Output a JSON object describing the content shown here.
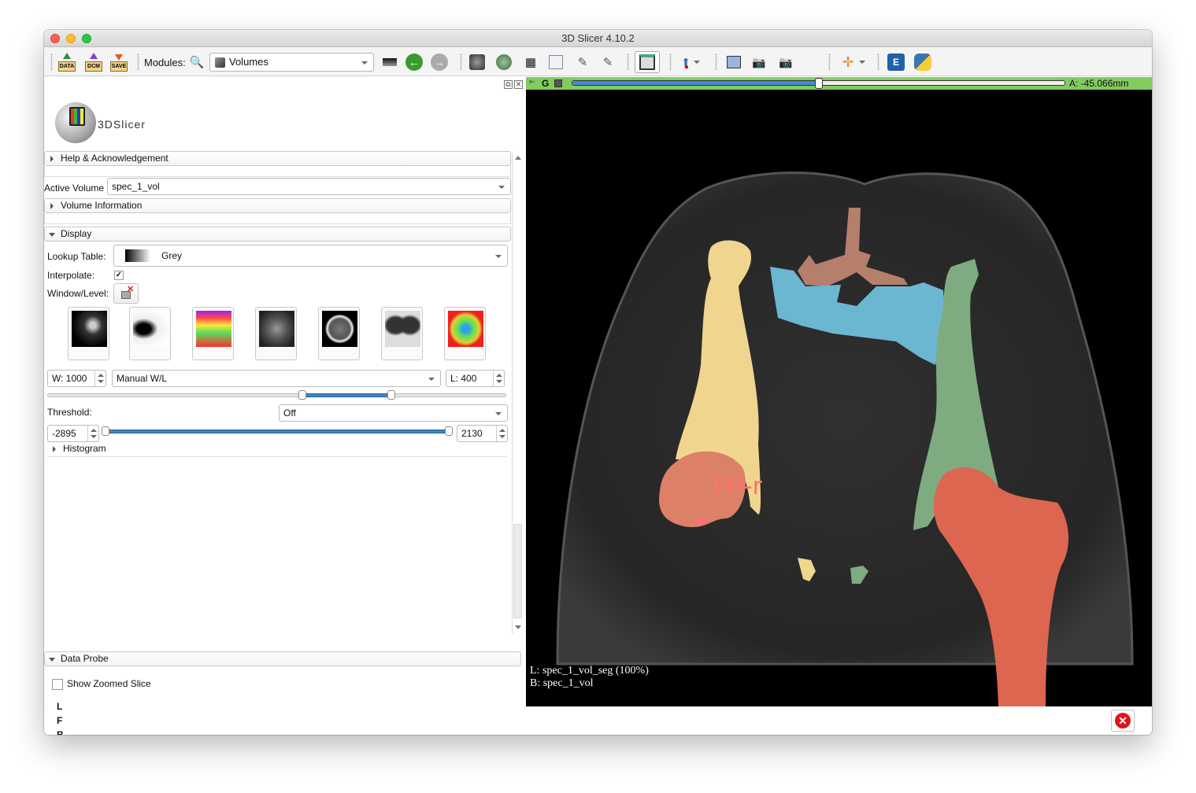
{
  "window": {
    "title": "3D Slicer 4.10.2"
  },
  "toolbar": {
    "data_button": "DATA",
    "dcm_button": "DCM",
    "save_button": "SAVE",
    "modules_label": "Modules:",
    "module_selected": "Volumes"
  },
  "panel": {
    "logo_text": "3DSlicer",
    "help_section": "Help & Acknowledgement",
    "active_volume_label": "Active Volume",
    "active_volume_value": "spec_1_vol",
    "volume_info_section": "Volume Information",
    "display_section": "Display",
    "lookup_table_label": "Lookup Table:",
    "lookup_table_value": "Grey",
    "interpolate_label": "Interpolate:",
    "interpolate_checked": true,
    "interpolate_mark": "✓",
    "window_level_label": "Window/Level:",
    "presets": [
      "CT-Bone",
      "CT-Air",
      "PET",
      "CT-Abdomen",
      "CT-Brain",
      "CT-Lung",
      "DTI"
    ],
    "window_value": "W: 1000",
    "wl_mode": "Manual W/L",
    "level_value": "L: 400",
    "wl_range_fraction": [
      0.555,
      0.75
    ],
    "threshold_label": "Threshold:",
    "threshold_mode": "Off",
    "threshold_min": "-2895",
    "threshold_max": "2130",
    "histogram_section": "Histogram",
    "data_probe_section": "Data Probe",
    "show_zoomed_slice_label": "Show Zoomed Slice",
    "show_zoomed_slice_checked": false,
    "probe_rows": [
      "L",
      "F",
      "B"
    ]
  },
  "slice_view": {
    "view_name": "G",
    "color": "#82cc5e",
    "slider_fraction": 0.5,
    "offset_text": "A: -45.066mm",
    "fiducial_label": "FH-r",
    "corner_label_layer": "L: spec_1_vol_seg (100%)",
    "corner_background_layer": "B: spec_1_vol",
    "segments": [
      {
        "name": "femur-left",
        "color": "#dd6650"
      },
      {
        "name": "femoral-head-right",
        "color": "#dd8068"
      },
      {
        "name": "pelvis-right",
        "color": "#f0d58f"
      },
      {
        "name": "pelvis-left",
        "color": "#7eac80"
      },
      {
        "name": "sacrum",
        "color": "#6bb7d1"
      },
      {
        "name": "vertebra",
        "color": "#b57f6b"
      }
    ]
  }
}
